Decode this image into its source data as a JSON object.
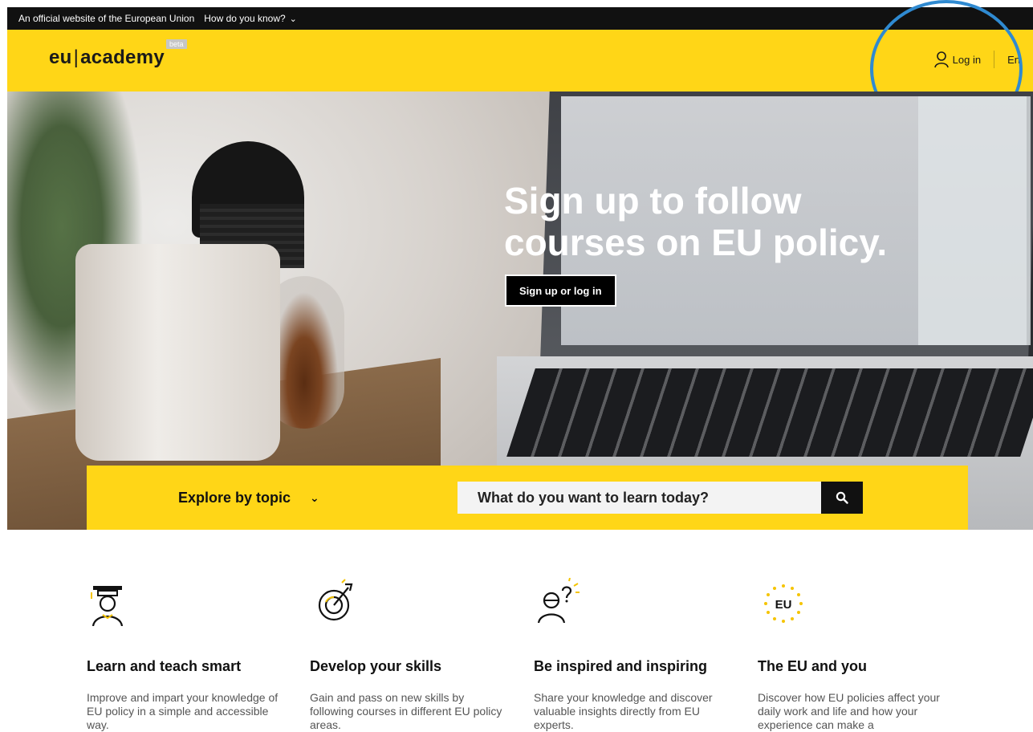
{
  "gov_bar": {
    "official_text": "An official website of the European Union",
    "how_text": "How do you know?"
  },
  "header": {
    "logo_left": "eu",
    "logo_sep": "|",
    "logo_right": "academy",
    "beta": "beta",
    "login_label": "Log in",
    "language": "En"
  },
  "hero": {
    "title": "Sign up to follow courses on EU policy.",
    "button_label": "Sign up or log in"
  },
  "search": {
    "explore_label": "Explore by topic",
    "placeholder": "What do you want to learn today?"
  },
  "features": [
    {
      "icon": "graduation-teacher-icon",
      "title": "Learn and teach smart",
      "desc": "Improve and impart your knowledge of EU policy in a simple and accessible way."
    },
    {
      "icon": "target-skills-icon",
      "title": "Develop your skills",
      "desc": "Gain and pass on new skills by following courses in different EU policy areas."
    },
    {
      "icon": "inspired-person-icon",
      "title": "Be inspired and inspiring",
      "desc": "Share your knowledge and discover valuable insights directly from EU experts."
    },
    {
      "icon": "eu-stars-icon",
      "title": "The EU and you",
      "desc": "Discover how EU policies affect your daily work and life and how your experience can make a"
    }
  ],
  "colors": {
    "brand_yellow": "#ffd617",
    "top_bar": "#111111",
    "annotation_blue": "#2f8ad1"
  }
}
